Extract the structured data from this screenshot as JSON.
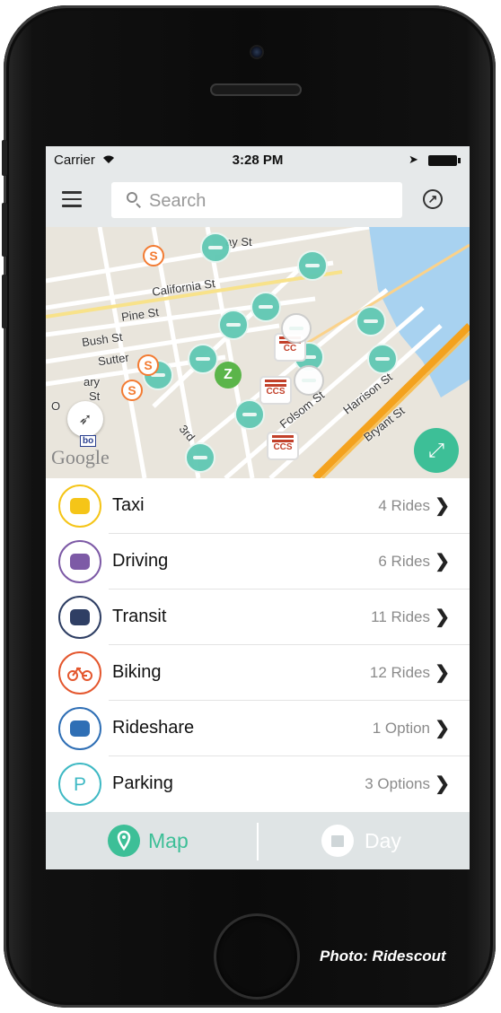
{
  "status": {
    "carrier": "Carrier",
    "time": "3:28 PM"
  },
  "search": {
    "placeholder": "Search"
  },
  "map": {
    "streets": [
      "ay St",
      "California St",
      "Pine St",
      "Bush St",
      "Sutter",
      "ary",
      "St",
      "O",
      "3rd",
      "Harrison St",
      "Bryant St",
      "Folsom St"
    ],
    "attribution": "Google",
    "badge": "bo",
    "pins": {
      "s": "S",
      "z": "Z",
      "ccs": "CCS",
      "cc": "CC"
    }
  },
  "rides": [
    {
      "label": "Taxi",
      "count": "4 Rides",
      "color": "#f5c518",
      "icon": "taxi-icon"
    },
    {
      "label": "Driving",
      "count": "6 Rides",
      "color": "#7d5aa6",
      "icon": "car-icon"
    },
    {
      "label": "Transit",
      "count": "11 Rides",
      "color": "#2f3f64",
      "icon": "bus-icon"
    },
    {
      "label": "Biking",
      "count": "12 Rides",
      "color": "#e4572e",
      "icon": "bike-icon"
    },
    {
      "label": "Rideshare",
      "count": "1 Option",
      "color": "#2f6fb5",
      "icon": "rideshare-car-icon"
    },
    {
      "label": "Parking",
      "count": "3 Options",
      "color": "#3fb9c4",
      "icon": "parking-icon",
      "glyph": "P"
    }
  ],
  "tabs": {
    "map": "Map",
    "day": "Day"
  },
  "colors": {
    "accent": "#3dbf97",
    "pin": "#5fc8b3",
    "tabbar": "#dfe4e5"
  },
  "credit": "Photo: Ridescout"
}
